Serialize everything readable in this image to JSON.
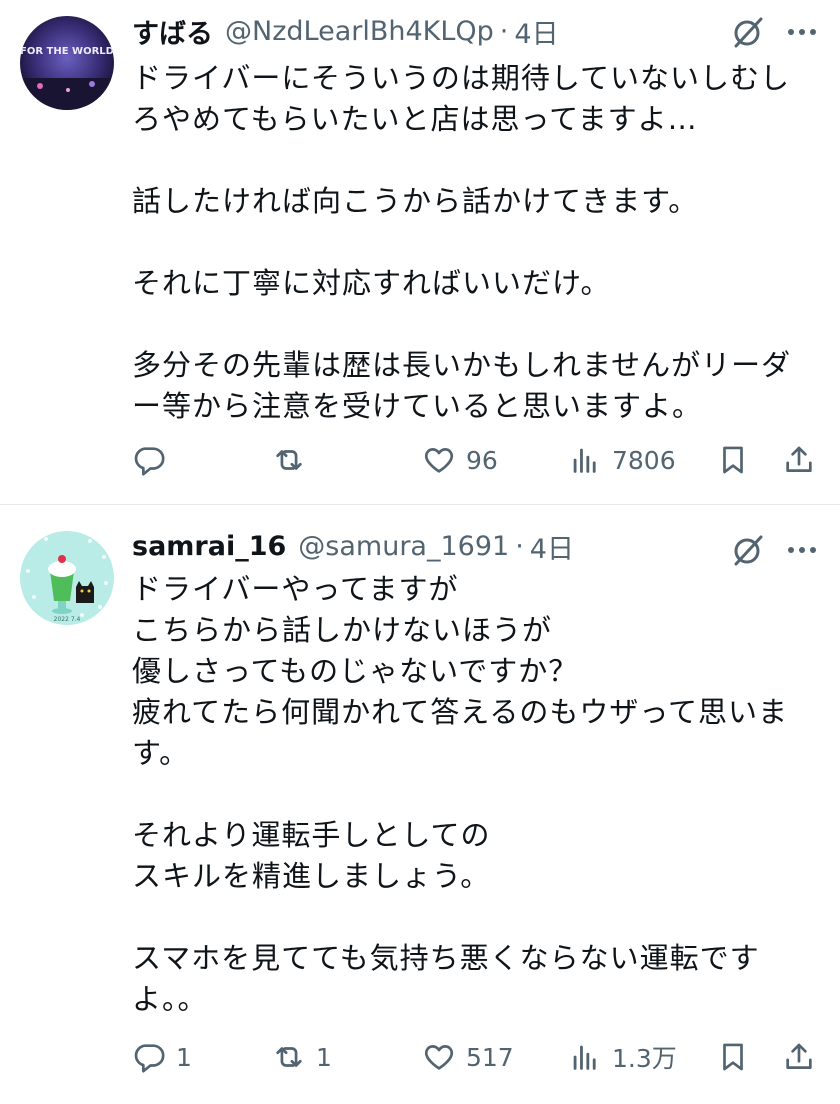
{
  "tweets": [
    {
      "user": {
        "name": "すばる",
        "handle": "@NzdLearlBh4KLQp",
        "time": "4日",
        "avatar_text": "FOR THE WORLD"
      },
      "text": "ドライバーにそういうのは期待していないしむし\nろやめてもらいたいと店は思ってますよ…\n\n話したければ向こうから話かけてきます。\n\nそれに丁寧に対応すればいいだけ。\n\n多分その先輩は歴は長いかもしれませんがリーダ\nー等から注意を受けていると思いますよ。",
      "stats": {
        "replies": "",
        "retweets": "",
        "likes": "96",
        "views": "7806"
      }
    },
    {
      "user": {
        "name": "samrai_16",
        "handle": "@samura_1691",
        "time": "4日",
        "avatar_text": "2022 7.4"
      },
      "text": "ドライバーやってますが\nこちらから話しかけないほうが\n優しさってものじゃないですか？\n疲れてたら何聞かれて答えるのもウザって思いま\nす。\n\nそれより運転手しとしての\nスキルを精進しましょう。\n\nスマホを見てても気持ち悪くならない運転です\nよ。。",
      "stats": {
        "replies": "1",
        "retweets": "1",
        "likes": "517",
        "views": "1.3万"
      }
    }
  ],
  "separator": "·",
  "icons": [
    "reply-icon",
    "retweet-icon",
    "like-icon",
    "views-icon",
    "bookmark-icon",
    "share-icon",
    "grok-icon",
    "more-icon"
  ],
  "colors": {
    "text": "#0f1419",
    "secondary": "#536471",
    "divider": "#e7e9ea"
  }
}
